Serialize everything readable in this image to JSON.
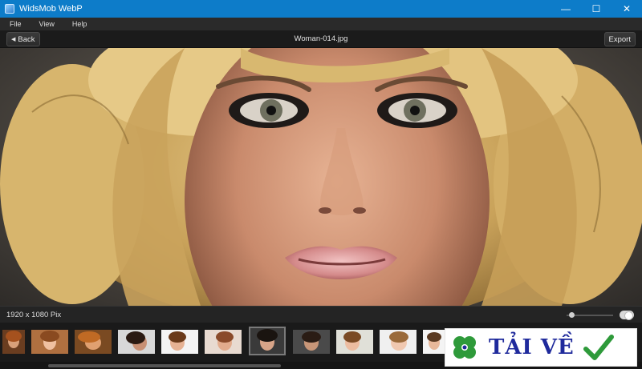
{
  "window": {
    "title": "WidsMob WebP",
    "controls": {
      "minimize": "—",
      "maximize": "☐",
      "close": "✕"
    },
    "accent": "#0d7cc9"
  },
  "menu": {
    "items": [
      "File",
      "View",
      "Help"
    ]
  },
  "toolbar": {
    "back_label": "Back",
    "export_label": "Export",
    "file_name": "Woman-014.jpg"
  },
  "viewer": {
    "image_description_icon": "portrait-photo"
  },
  "status": {
    "dimensions": "1920 x 1080 Pix",
    "zoom_level": 0.05,
    "toggle_on": true
  },
  "filmstrip": {
    "thumbnails": [
      {
        "icon": "portrait-thumbnail",
        "selected": false
      },
      {
        "icon": "portrait-thumbnail",
        "selected": false
      },
      {
        "icon": "portrait-thumbnail",
        "selected": false
      },
      {
        "icon": "portrait-thumbnail",
        "selected": false
      },
      {
        "icon": "portrait-thumbnail",
        "selected": false
      },
      {
        "icon": "portrait-thumbnail",
        "selected": false
      },
      {
        "icon": "portrait-thumbnail",
        "selected": true
      },
      {
        "icon": "portrait-thumbnail",
        "selected": false
      },
      {
        "icon": "portrait-thumbnail",
        "selected": false
      },
      {
        "icon": "portrait-thumbnail",
        "selected": false
      },
      {
        "icon": "portrait-thumbnail",
        "selected": false
      }
    ]
  },
  "watermark": {
    "text": "TẢI VỀ",
    "brand_color": "#1f2a9c",
    "check_color": "#2e9a3a"
  }
}
